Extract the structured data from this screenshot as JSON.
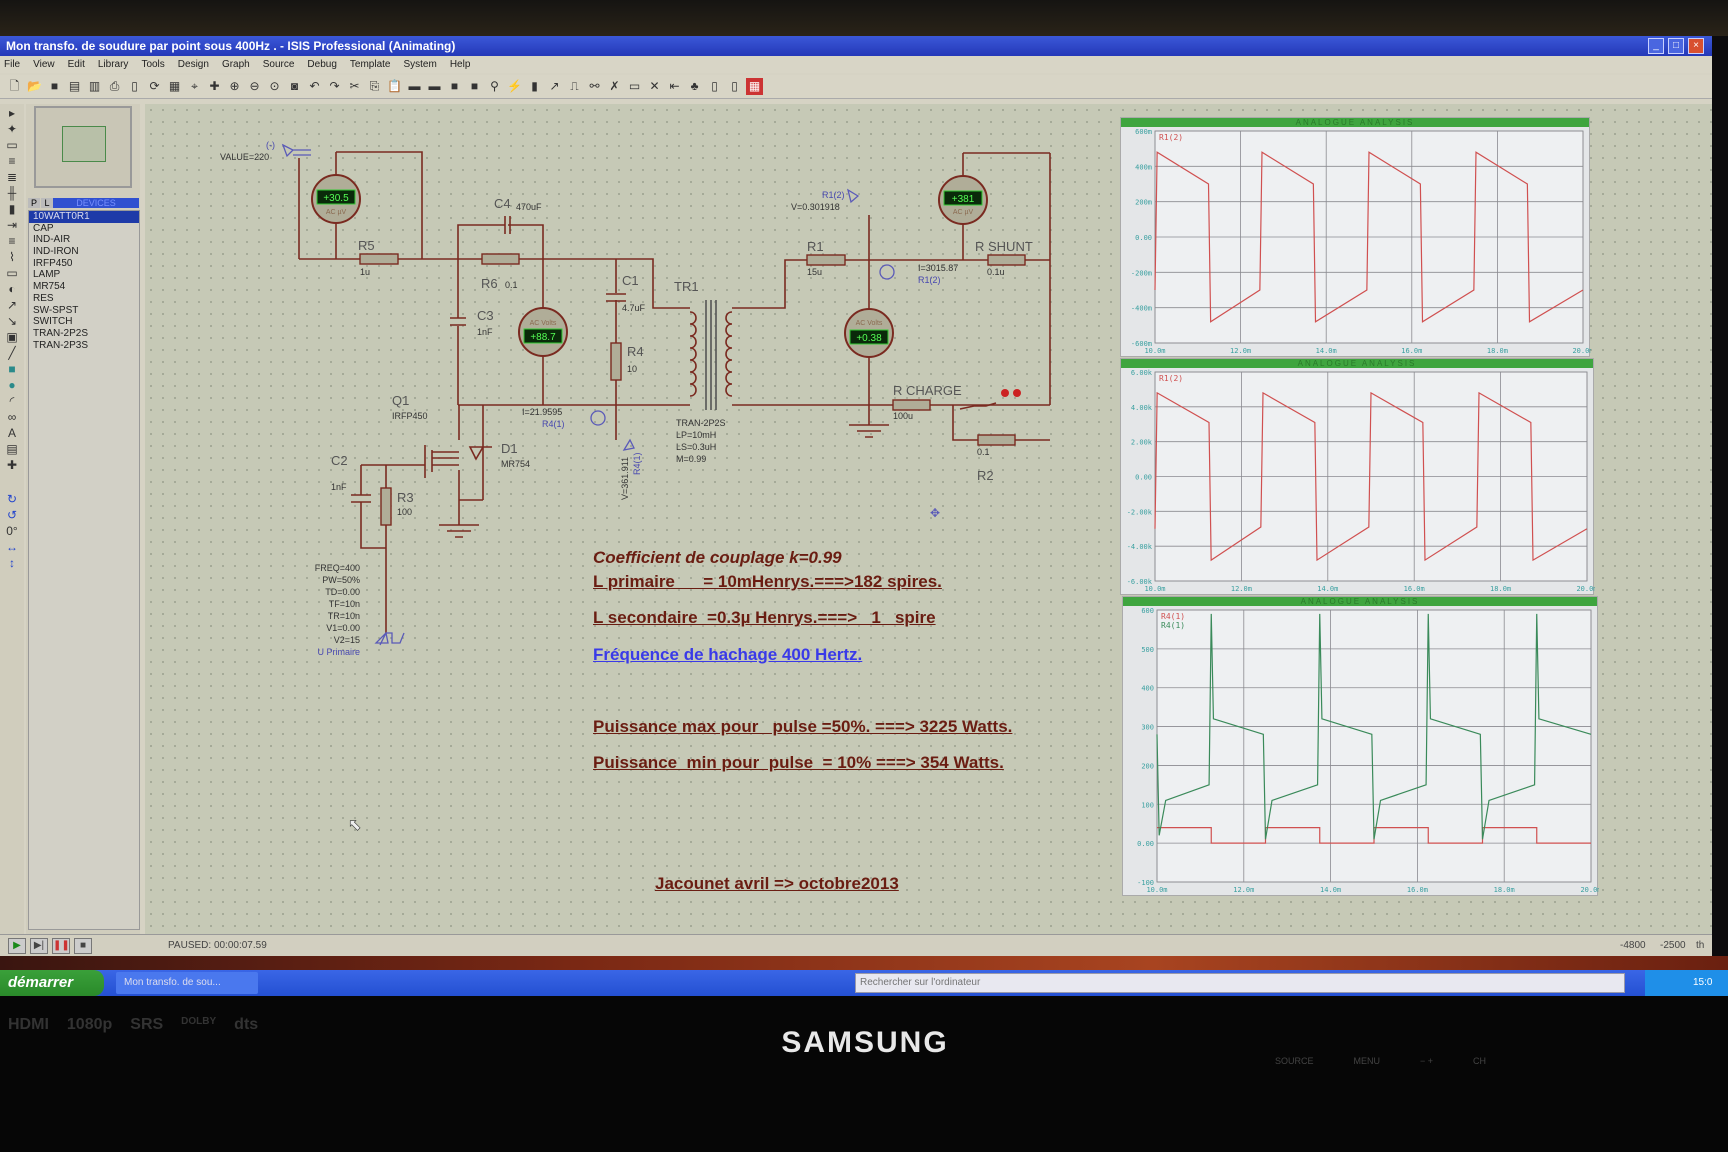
{
  "window": {
    "title": "Mon transfo. de  soudure par point sous 400Hz . - ISIS Professional (Animating)"
  },
  "menu": [
    "File",
    "View",
    "Edit",
    "Library",
    "Tools",
    "Design",
    "Graph",
    "Source",
    "Debug",
    "Template",
    "System",
    "Help"
  ],
  "devices": {
    "tab_p": "P",
    "tab_l": "L",
    "header": "DEVICES",
    "items": [
      "10WATT0R1",
      "CAP",
      "IND-AIR",
      "IND-IRON",
      "IRFP450",
      "LAMP",
      "MR754",
      "RES",
      "SW-SPST",
      "SWITCH",
      "TRAN-2P2S",
      "TRAN-2P3S"
    ],
    "selected": 0
  },
  "schematic": {
    "value_label": "VALUE=220",
    "neg_label": "(-)",
    "meters": [
      {
        "reading": "+30.5",
        "unit": "AC µV"
      },
      {
        "reading": "+88.7",
        "unit": "AC Volts"
      },
      {
        "reading": "+0.38",
        "unit": "AC Volts"
      },
      {
        "reading": "+381",
        "unit": "AC µV"
      }
    ],
    "parts": {
      "R5": "R5",
      "R5v": "1u",
      "C4": "C4",
      "C4v": "470uF",
      "R6": "R6",
      "R6v": "0.1",
      "C3": "C3",
      "C3v": "1nF",
      "C1": "C1",
      "C1v": "4.7uF",
      "R4": "R4",
      "R4v": "10",
      "TR1": "TR1",
      "TR1v": [
        "TRAN-2P2S",
        "LP=10mH",
        "LS=0.3uH",
        "M=0.99"
      ],
      "R1": "R1",
      "R1v": "15u",
      "RSHUNT": "R SHUNT",
      "RSHUNTv": "0.1u",
      "RCHARGE": "R CHARGE",
      "RCHARGEv": "100u",
      "R2": "R2",
      "R2v": "0.1",
      "Q1": "Q1",
      "Q1v": "IRFP450",
      "D1": "D1",
      "D1v": "MR754",
      "C2": "C2",
      "C2v": "1nF",
      "R3": "R3",
      "R3v": "100"
    },
    "probes": {
      "r12_name": "R1(2)",
      "r12_v": "V=0.301918",
      "r12_i": "I=3015.87",
      "r12_i_name": "R1(2)",
      "r41_i": "I=21.9595",
      "r41_name": "R4(1)",
      "r41_v": "V=361.911",
      "r41_v_name": "R4(1)"
    },
    "source_params": [
      "FREQ=400",
      "PW=50%",
      "TD=0.00",
      "TF=10n",
      "TR=10n",
      "V1=0.00",
      "V2=15"
    ],
    "source_name": "U Primaire"
  },
  "notes": {
    "coupling": "Coefficient de couplage k=0.99",
    "lprim": "L primaire      = 10mHenrys.===>182 spires.",
    "lsec": "L secondaire  =0.3µ Henrys.===>   1   spire",
    "freq": "Fréquence de hachage 400 Hertz.",
    "pmax": "Puissance max pour   pulse =50%. ===> 3225 Watts.",
    "pmin": "Puissance  min pour  pulse  = 10% ===> 354 Watts.",
    "author": "Jacounet avril => octobre2013"
  },
  "status": {
    "text": "PAUSED: 00:00:07.59",
    "coord_x": "-4800",
    "coord_y": "-2500",
    "unit": "th"
  },
  "taskbar": {
    "start": "démarrer",
    "task": "Mon transfo. de  sou...",
    "search_placeholder": "Rechercher sur l'ordinateur",
    "clock": "15:0"
  },
  "monitor": {
    "brand": "SAMSUNG",
    "logos": [
      "HDMI",
      "1080p",
      "SRS",
      "DOLBY",
      "dts"
    ],
    "controls": [
      "SOURCE",
      "MENU",
      "−  +",
      "CH"
    ]
  },
  "colors": {
    "trace_red": "#d05050",
    "trace_green": "#3a8a5a",
    "grid": "#8a8a90",
    "axis_text": "#3aa0a0",
    "header": "#3fa53f"
  },
  "chart_data": [
    {
      "type": "line",
      "title": "ANALOGUE ANALYSIS",
      "xlim": [
        10,
        20
      ],
      "ylim": [
        -600,
        600
      ],
      "xticks": [
        "10.0m",
        "12.0m",
        "14.0m",
        "16.0m",
        "18.0m",
        "20.0m"
      ],
      "yticks": [
        "600m",
        "400m",
        "200m",
        "0.00",
        "-200m",
        "-400m",
        "-600m"
      ],
      "series": [
        {
          "name": "R1(2)",
          "color": "#d05050",
          "points": [
            [
              10,
              -300
            ],
            [
              10.05,
              480
            ],
            [
              11.25,
              300
            ],
            [
              11.3,
              -480
            ],
            [
              12.45,
              -300
            ],
            [
              12.5,
              480
            ],
            [
              13.7,
              300
            ],
            [
              13.75,
              -480
            ],
            [
              14.95,
              -300
            ],
            [
              15,
              480
            ],
            [
              16.2,
              300
            ],
            [
              16.25,
              -480
            ],
            [
              17.45,
              -300
            ],
            [
              17.5,
              480
            ],
            [
              18.7,
              300
            ],
            [
              18.75,
              -480
            ],
            [
              20,
              -300
            ]
          ]
        }
      ]
    },
    {
      "type": "line",
      "title": "ANALOGUE ANALYSIS",
      "xlim": [
        10,
        20
      ],
      "ylim": [
        -6000,
        6000
      ],
      "xticks": [
        "10.0m",
        "12.0m",
        "14.0m",
        "16.0m",
        "18.0m",
        "20.0m"
      ],
      "yticks": [
        "6.00k",
        "4.00k",
        "2.00k",
        "0.00",
        "-2.00k",
        "-4.00k",
        "-6.00k"
      ],
      "series": [
        {
          "name": "R1(2)",
          "color": "#d05050",
          "points": [
            [
              10,
              -3000
            ],
            [
              10.05,
              4800
            ],
            [
              11.25,
              3100
            ],
            [
              11.3,
              -4800
            ],
            [
              12.45,
              -2900
            ],
            [
              12.5,
              4800
            ],
            [
              13.7,
              3100
            ],
            [
              13.75,
              -4800
            ],
            [
              14.95,
              -2900
            ],
            [
              15,
              4800
            ],
            [
              16.2,
              3100
            ],
            [
              16.25,
              -4800
            ],
            [
              17.45,
              -2900
            ],
            [
              17.5,
              4800
            ],
            [
              18.7,
              3100
            ],
            [
              18.75,
              -4800
            ],
            [
              20,
              -3000
            ]
          ]
        }
      ]
    },
    {
      "type": "line",
      "title": "ANALOGUE ANALYSIS",
      "xlim": [
        10,
        20
      ],
      "ylim": [
        -100,
        600
      ],
      "xticks": [
        "10.0m",
        "12.0m",
        "14.0m",
        "16.0m",
        "18.0m",
        "20.0m"
      ],
      "yticks": [
        "600",
        "500",
        "400",
        "300",
        "200",
        "100",
        "0.00",
        "-100"
      ],
      "series": [
        {
          "name": "R4(1)",
          "color": "#d05050",
          "points": [
            [
              10,
              40
            ],
            [
              11.25,
              40
            ],
            [
              11.25,
              0
            ],
            [
              12.5,
              0
            ],
            [
              12.5,
              40
            ],
            [
              13.75,
              40
            ],
            [
              13.75,
              0
            ],
            [
              15,
              0
            ],
            [
              15,
              40
            ],
            [
              16.25,
              40
            ],
            [
              16.25,
              0
            ],
            [
              17.5,
              0
            ],
            [
              17.5,
              40
            ],
            [
              18.75,
              40
            ],
            [
              18.75,
              0
            ],
            [
              20,
              0
            ]
          ]
        },
        {
          "name": "R4(1)",
          "color": "#3a8a5a",
          "points": [
            [
              10,
              280
            ],
            [
              10.05,
              20
            ],
            [
              10.2,
              110
            ],
            [
              11.2,
              150
            ],
            [
              11.25,
              590
            ],
            [
              11.3,
              320
            ],
            [
              12.45,
              280
            ],
            [
              12.5,
              10
            ],
            [
              12.65,
              110
            ],
            [
              13.7,
              150
            ],
            [
              13.75,
              590
            ],
            [
              13.8,
              320
            ],
            [
              14.95,
              280
            ],
            [
              15,
              10
            ],
            [
              15.15,
              110
            ],
            [
              16.2,
              150
            ],
            [
              16.25,
              590
            ],
            [
              16.3,
              320
            ],
            [
              17.45,
              280
            ],
            [
              17.5,
              10
            ],
            [
              17.65,
              110
            ],
            [
              18.7,
              150
            ],
            [
              18.75,
              590
            ],
            [
              18.8,
              320
            ],
            [
              20,
              280
            ]
          ]
        }
      ]
    }
  ]
}
